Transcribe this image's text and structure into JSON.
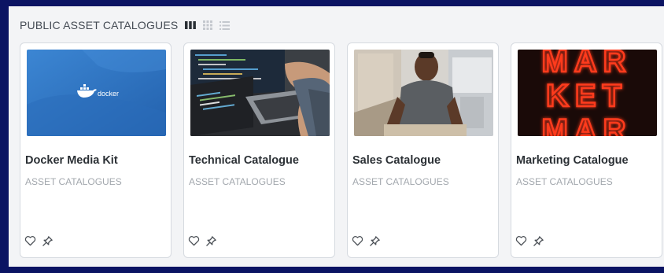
{
  "section": {
    "title": "PUBLIC ASSET CATALOGUES",
    "view_icons": [
      "columns-view-icon",
      "grid-view-icon",
      "list-view-icon"
    ]
  },
  "cards": [
    {
      "title": "Docker Media Kit",
      "subtitle": "ASSET CATALOGUES",
      "image": "docker-whale-logo-on-blue",
      "logo_text": "docker"
    },
    {
      "title": "Technical Catalogue",
      "subtitle": "ASSET CATALOGUES",
      "image": "laptop-with-code-photo"
    },
    {
      "title": "Sales Catalogue",
      "subtitle": "ASSET CATALOGUES",
      "image": "man-in-office-photo"
    },
    {
      "title": "Marketing Catalogue",
      "subtitle": "ASSET CATALOGUES",
      "image": "neon-market-sign-photo",
      "sign_text": [
        "MAR",
        "KET",
        "MAR"
      ]
    }
  ],
  "colors": {
    "frame": "#0b1463",
    "panel": "#f3f4f6",
    "docker_blue": "#2f78c7",
    "neon_red": "#ff3b1f"
  }
}
